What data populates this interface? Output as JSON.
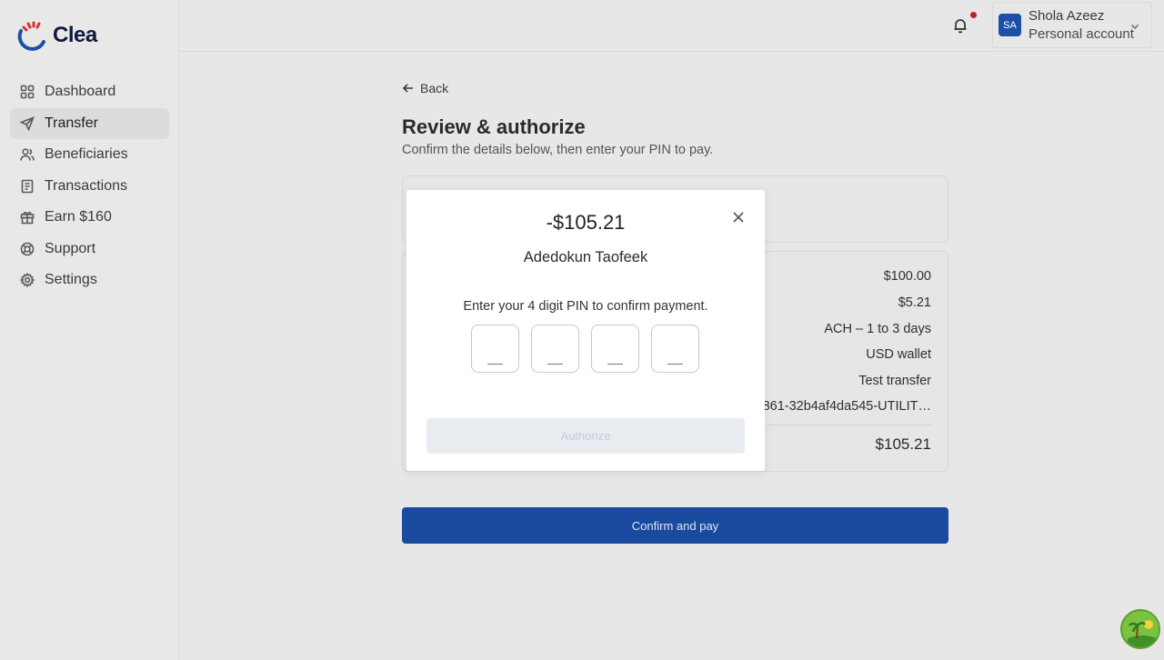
{
  "brand": {
    "name": "Clea"
  },
  "sidebar": {
    "items": [
      {
        "label": "Dashboard",
        "icon": "grid-icon",
        "active": false
      },
      {
        "label": "Transfer",
        "icon": "send-icon",
        "active": true
      },
      {
        "label": "Beneficiaries",
        "icon": "users-icon",
        "active": false
      },
      {
        "label": "Transactions",
        "icon": "receipt-icon",
        "active": false
      },
      {
        "label": "Earn $160",
        "icon": "gift-icon",
        "active": false
      },
      {
        "label": "Support",
        "icon": "lifebuoy-icon",
        "active": false
      },
      {
        "label": "Settings",
        "icon": "gear-icon",
        "active": false
      }
    ]
  },
  "header": {
    "notification_dot_color": "#c0202a",
    "account": {
      "initials": "SA",
      "name": "Shola Azeez",
      "type": "Personal account"
    }
  },
  "main": {
    "back_label": "Back",
    "title": "Review & authorize",
    "subtitle": "Confirm the details below, then enter your PIN to pay.",
    "details": {
      "values": [
        "$100.00",
        "$5.21",
        "ACH – 1 to 3 days",
        "USD wallet",
        "Test transfer",
        "0861-32b4af4da545-UTILIT…"
      ],
      "total": "$105.21"
    },
    "confirm_label": "Confirm and pay"
  },
  "modal": {
    "amount": "-$105.21",
    "recipient": "Adedokun Taofeek",
    "prompt": "Enter your 4 digit PIN to confirm payment.",
    "pin_length": 4,
    "authorize_label": "Authorize"
  },
  "colors": {
    "primary": "#1a4a9e",
    "background": "#e7e7e7",
    "modal": "#ffffff"
  }
}
